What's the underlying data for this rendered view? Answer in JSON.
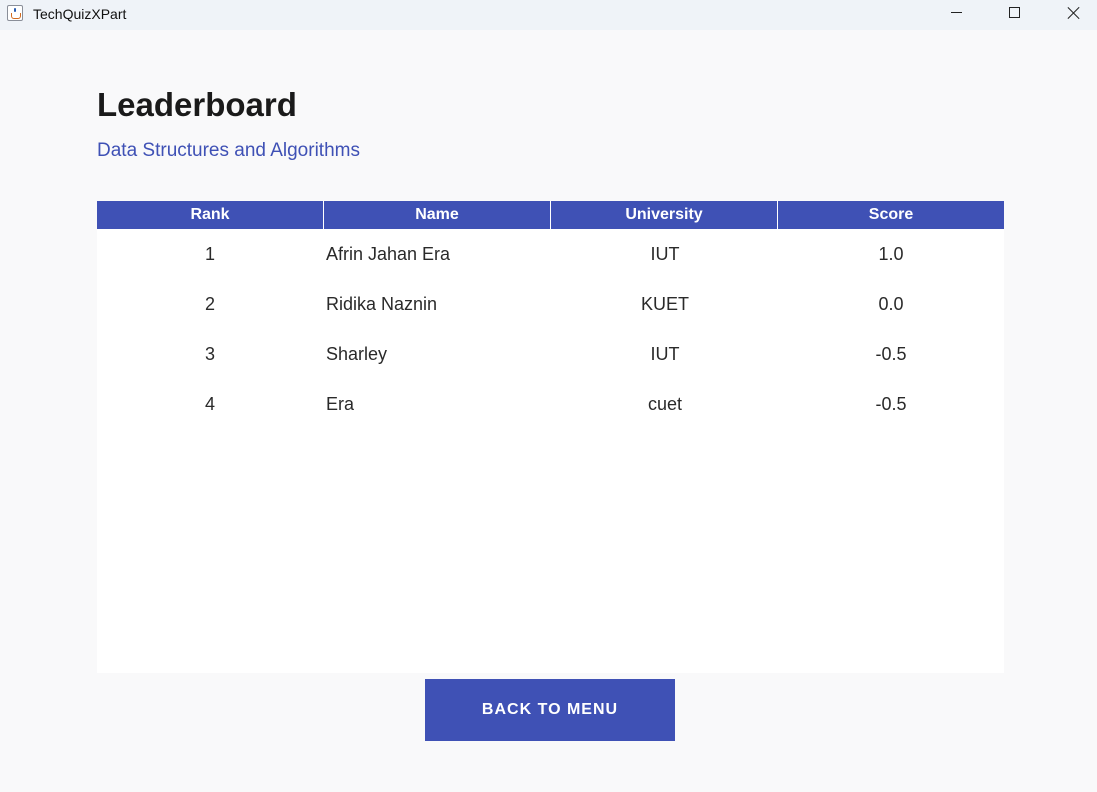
{
  "window": {
    "title": "TechQuizXPart",
    "icon": "java-cup-icon",
    "controls": [
      "minimize-icon",
      "maximize-icon",
      "close-icon"
    ]
  },
  "page": {
    "heading": "Leaderboard",
    "subheading": "Data Structures and Algorithms"
  },
  "table": {
    "columns": [
      "Rank",
      "Name",
      "University",
      "Score"
    ],
    "rows": [
      {
        "rank": "1",
        "name": "Afrin Jahan Era",
        "university": "IUT",
        "score": "1.0"
      },
      {
        "rank": "2",
        "name": "Ridika Naznin",
        "university": "KUET",
        "score": "0.0"
      },
      {
        "rank": "3",
        "name": "Sharley",
        "university": "IUT",
        "score": "-0.5"
      },
      {
        "rank": "4",
        "name": "Era",
        "university": "cuet",
        "score": "-0.5"
      }
    ]
  },
  "actions": {
    "back_label": "BACK TO MENU"
  },
  "colors": {
    "accent": "#3f51b5",
    "background": "#f9f9fa",
    "titlebar": "#eff3f8"
  }
}
